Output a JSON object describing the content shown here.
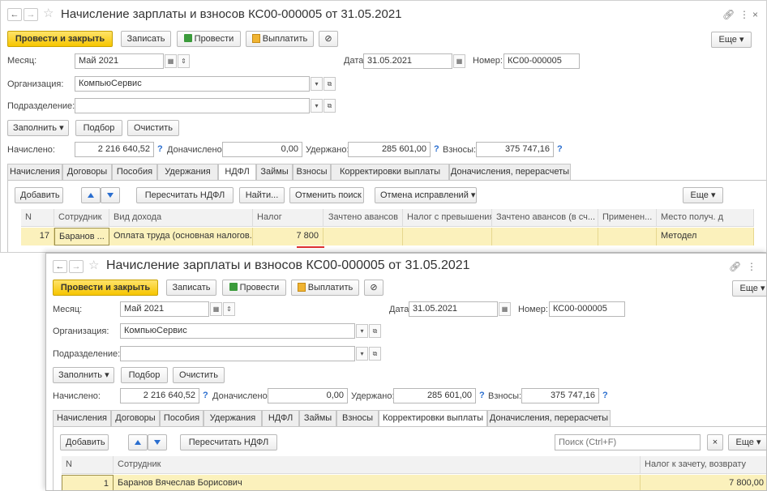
{
  "doc_title": "Начисление зарплаты и взносов КС00-000005 от 31.05.2021",
  "toolbar": {
    "post_close": "Провести и закрыть",
    "save": "Записать",
    "post": "Провести",
    "pay": "Выплатить",
    "more": "Еще"
  },
  "header": {
    "month_label": "Месяц:",
    "month_value": "Май 2021",
    "date_label": "Дата:",
    "date_value": "31.05.2021",
    "number_label": "Номер:",
    "number_value": "КС00-000005",
    "org_label": "Организация:",
    "org_value": "КомпьюСервис",
    "dept_label": "Подразделение:",
    "dept_value": ""
  },
  "actions": {
    "fill": "Заполнить",
    "select": "Подбор",
    "clear": "Очистить"
  },
  "totals": {
    "accrued_label": "Начислено:",
    "accrued_value": "2 216 640,52",
    "additional_label": "Доначислено:",
    "additional_value": "0,00",
    "withheld_label": "Удержано:",
    "withheld_value": "285 601,00",
    "contrib_label": "Взносы:",
    "contrib_value": "375 747,16",
    "q": "?"
  },
  "tabs": [
    "Начисления",
    "Договоры",
    "Пособия",
    "Удержания",
    "НДФЛ",
    "Займы",
    "Взносы",
    "Корректировки выплаты",
    "Доначисления, перерасчеты"
  ],
  "window1": {
    "active_tab": "НДФЛ",
    "table_toolbar": {
      "add": "Добавить",
      "recalc": "Пересчитать НДФЛ",
      "find": "Найти...",
      "cancel_search": "Отменить поиск",
      "cancel_fixes": "Отмена исправлений",
      "more": "Еще"
    },
    "columns": [
      "N",
      "Сотрудник",
      "Вид дохода",
      "Налог",
      "Зачтено авансов",
      "Налог с превышения",
      "Зачтено авансов (в сч...",
      "Применен...",
      "Место получ. д"
    ],
    "row": {
      "n": "17",
      "employee": "Баранов ...",
      "income_type": "Оплата труда (основная налогов...",
      "tax": "7 800",
      "advances": "",
      "excess_tax": "",
      "advances2": "",
      "applied": "",
      "place": "Методел"
    }
  },
  "window2": {
    "active_tab": "Корректировки выплаты",
    "table_toolbar": {
      "add": "Добавить",
      "recalc": "Пересчитать НДФЛ",
      "search_placeholder": "Поиск (Ctrl+F)",
      "clear_search": "×",
      "more": "Еще"
    },
    "columns": [
      "N",
      "Сотрудник",
      "Налог к зачету, возврату"
    ],
    "row": {
      "n": "1",
      "employee": "Баранов Вячеслав Борисович",
      "tax_offset": "7 800,00"
    }
  },
  "colors": {
    "primary_button": "#f6c500",
    "selected_row": "#fbf1bc",
    "highlight_underline": "#e03030",
    "help_mark": "#2a6ecf"
  }
}
